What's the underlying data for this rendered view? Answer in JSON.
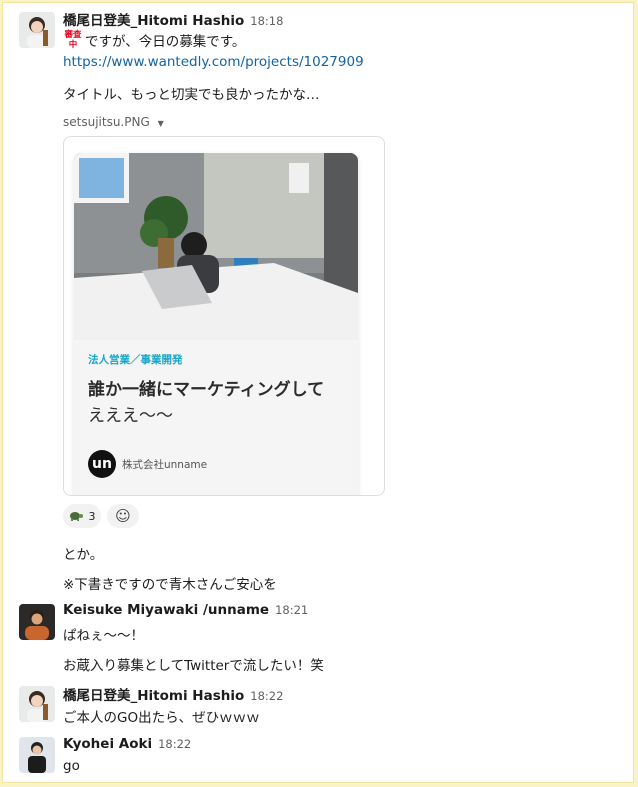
{
  "messages": [
    {
      "author": "橋尾日登美_Hitomi Hashio",
      "time": "18:18",
      "badge": "審査中",
      "lines": [
        "ですが、今日の募集です。",
        "https://www.wantedly.com/projects/1027909",
        "タイトル、もっと切実でも良かったかな…"
      ],
      "attachment": {
        "filename": "setsujitsu.PNG",
        "category": "法人営業／事業開発",
        "title_line1": "誰か一緒にマーケティングして",
        "title_line2": "えええ〜〜",
        "company": "株式会社unname",
        "company_logo_text": "un"
      },
      "reactions": [
        {
          "emoji": "turtle-icon",
          "count": "3"
        }
      ],
      "followups": [
        "とか。",
        "※下書きですので青木さんご安心を"
      ]
    },
    {
      "author": "Keisuke Miyawaki /unname",
      "time": "18:21",
      "lines": [
        "ぱねぇ〜〜！",
        "お蔵入り募集としてTwitterで流したい！笑"
      ]
    },
    {
      "author": "橋尾日登美_Hitomi Hashio",
      "time": "18:22",
      "lines": [
        "ご本人のGO出たら、ぜひｗｗｗ"
      ]
    },
    {
      "author": "Kyohei Aoki",
      "time": "18:22",
      "lines": [
        "go"
      ]
    }
  ],
  "colors": {
    "link": "#1264a3",
    "category": "#1aa6c9",
    "badge": "#e8001c",
    "border": "#fbf3c8"
  }
}
